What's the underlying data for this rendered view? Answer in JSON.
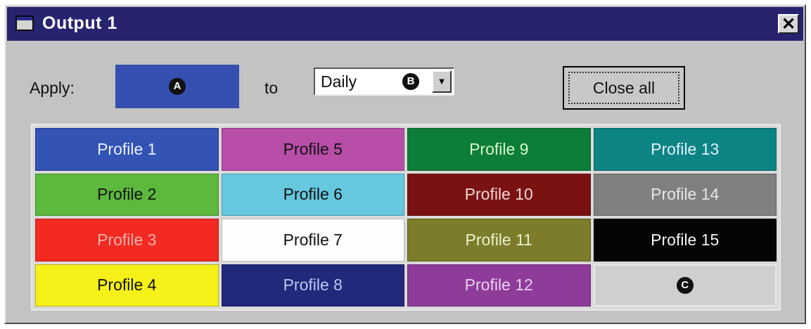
{
  "window": {
    "title": "Output 1",
    "close_glyph": "✕"
  },
  "apply": {
    "label": "Apply:",
    "selected_color": "#3550b0",
    "badge_a": "A"
  },
  "to": {
    "label": "to",
    "select_value": "Daily",
    "badge_b": "B",
    "arrow_glyph": "▼"
  },
  "close_all": {
    "label": "Close all"
  },
  "profiles": [
    {
      "label": "Profile 1",
      "bg": "#3353b5",
      "fg": "#e8f0ff"
    },
    {
      "label": "Profile 5",
      "bg": "#b84ea8",
      "fg": "#111111"
    },
    {
      "label": "Profile 9",
      "bg": "#0d7d3a",
      "fg": "#d9f7c8"
    },
    {
      "label": "Profile 13",
      "bg": "#0d8484",
      "fg": "#e0f2ff"
    },
    {
      "label": "Profile 2",
      "bg": "#5cb93e",
      "fg": "#111111"
    },
    {
      "label": "Profile 6",
      "bg": "#66c8df",
      "fg": "#111111"
    },
    {
      "label": "Profile 10",
      "bg": "#7a1212",
      "fg": "#f2d6d6"
    },
    {
      "label": "Profile 14",
      "bg": "#808080",
      "fg": "#e6e6e6"
    },
    {
      "label": "Profile 3",
      "bg": "#f22a22",
      "fg": "#f7b0a8"
    },
    {
      "label": "Profile 7",
      "bg": "#fdfdfd",
      "fg": "#111111"
    },
    {
      "label": "Profile 11",
      "bg": "#7c7c2a",
      "fg": "#e8f2d0"
    },
    {
      "label": "Profile 15",
      "bg": "#050505",
      "fg": "#f3f3f3"
    },
    {
      "label": "Profile 4",
      "bg": "#f6f019",
      "fg": "#111111"
    },
    {
      "label": "Profile 8",
      "bg": "#22287a",
      "fg": "#b9c8f2"
    },
    {
      "label": "Profile 12",
      "bg": "#8f3b9a",
      "fg": "#e6d2ee"
    },
    {
      "label": "",
      "bg": "#cfcfcf",
      "fg": "#111111",
      "badge": "C"
    }
  ]
}
